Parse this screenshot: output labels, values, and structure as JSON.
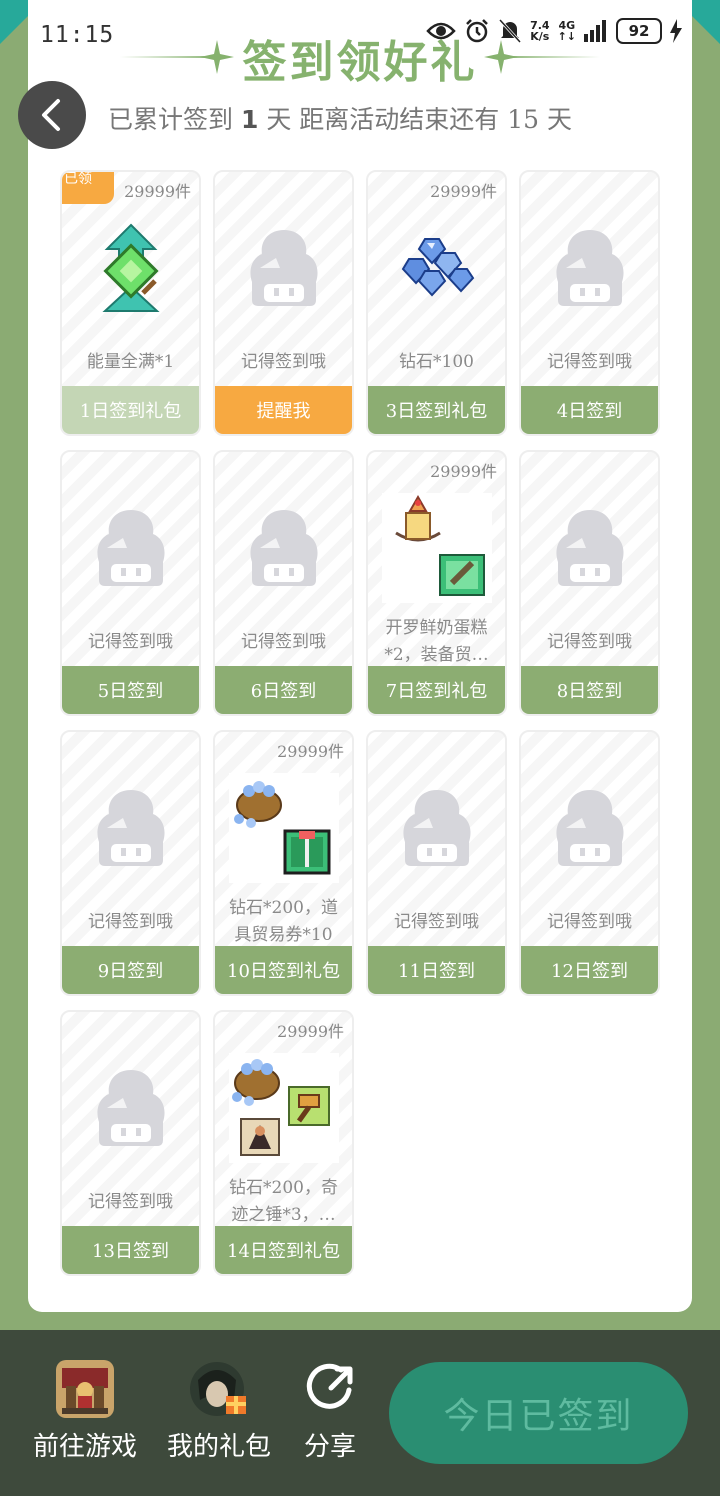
{
  "status": {
    "time": "11:15",
    "net_speed_top": "7.4",
    "net_speed_bottom": "K/s",
    "network": "4G",
    "battery": "92"
  },
  "header": {
    "title": "签到领好礼",
    "subtitle_prefix": "已累计签到",
    "signed_days": "1",
    "subtitle_mid": "天  距离活动结束还有",
    "remaining_days": "15",
    "subtitle_suffix": "天"
  },
  "cards": [
    {
      "count": "29999件",
      "badge": "已领",
      "desc": "能量全满*1",
      "footer": "1日签到礼包",
      "icon": "energy-crystal-icon",
      "state": "claimed"
    },
    {
      "count": "",
      "badge": "",
      "desc": "记得签到哦",
      "footer": "提醒我",
      "icon": "placeholder-avatar-icon",
      "state": "remind"
    },
    {
      "count": "29999件",
      "badge": "",
      "desc": "钻石*100",
      "footer": "3日签到礼包",
      "icon": "diamonds-icon",
      "state": "normal"
    },
    {
      "count": "",
      "badge": "",
      "desc": "记得签到哦",
      "footer": "4日签到",
      "icon": "placeholder-avatar-icon",
      "state": "normal"
    },
    {
      "count": "",
      "badge": "",
      "desc": "记得签到哦",
      "footer": "5日签到",
      "icon": "placeholder-avatar-icon",
      "state": "normal"
    },
    {
      "count": "",
      "badge": "",
      "desc": "记得签到哦",
      "footer": "6日签到",
      "icon": "placeholder-avatar-icon",
      "state": "normal"
    },
    {
      "count": "29999件",
      "badge": "",
      "desc": "开罗鲜奶蛋糕*2，装备贸…",
      "footer": "7日签到礼包",
      "icon": "cake-and-ticket-icon",
      "state": "normal"
    },
    {
      "count": "",
      "badge": "",
      "desc": "记得签到哦",
      "footer": "8日签到",
      "icon": "placeholder-avatar-icon",
      "state": "normal"
    },
    {
      "count": "",
      "badge": "",
      "desc": "记得签到哦",
      "footer": "9日签到",
      "icon": "placeholder-avatar-icon",
      "state": "normal"
    },
    {
      "count": "29999件",
      "badge": "",
      "desc": "钻石*200，道具贸易券*10",
      "footer": "10日签到礼包",
      "icon": "diamond-bag-and-ticket-icon",
      "state": "normal"
    },
    {
      "count": "",
      "badge": "",
      "desc": "记得签到哦",
      "footer": "11日签到",
      "icon": "placeholder-avatar-icon",
      "state": "normal"
    },
    {
      "count": "",
      "badge": "",
      "desc": "记得签到哦",
      "footer": "12日签到",
      "icon": "placeholder-avatar-icon",
      "state": "normal"
    },
    {
      "count": "",
      "badge": "",
      "desc": "记得签到哦",
      "footer": "13日签到",
      "icon": "placeholder-avatar-icon",
      "state": "normal"
    },
    {
      "count": "29999件",
      "badge": "",
      "desc": "钻石*200，奇迹之锤*3，…",
      "footer": "14日签到礼包",
      "icon": "diamond-bag-hammer-icon",
      "state": "normal"
    }
  ],
  "bottom": {
    "go_game": "前往游戏",
    "my_gifts": "我的礼包",
    "share": "分享",
    "signed_today": "今日已签到"
  },
  "colors": {
    "background": "#8bab73",
    "accent_green": "#86b26e",
    "footer_green": "#8cad72",
    "orange": "#f7a941",
    "teal_button": "#2a8e72"
  }
}
